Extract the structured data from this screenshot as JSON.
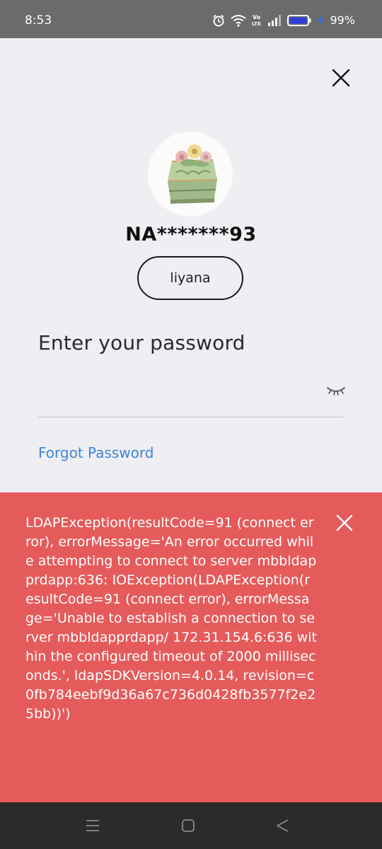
{
  "status_bar": {
    "time": "8:53",
    "battery_percent": "99%",
    "icons": [
      "alarm-icon",
      "wifi-icon",
      "volte-icon",
      "signal-icon",
      "battery-icon",
      "charging-icon"
    ]
  },
  "header": {
    "close_icon": "close-icon"
  },
  "profile": {
    "masked_id": "NA*******93",
    "username": "liyana"
  },
  "password": {
    "label": "Enter your password",
    "value": "",
    "placeholder": "",
    "toggle_icon": "eye-closed-icon"
  },
  "forgot_password": "Forgot Password",
  "error": {
    "message": "LDAPException(resultCode=91 (connect error), errorMessage='An error occurred while attempting to connect to server mbbldapprdapp:636:  IOException(LDAPException(resultCode=91 (connect error), errorMessage='Unable to establish a connection to server mbbldapprdapp/ 172.31.154.6:636 within the configured timeout of 2000 milliseconds.', ldapSDKVersion=4.0.14, revision=c0fb784eebf9d36a67c736d0428fb3577f2e25bb))')",
    "background_color": "#e55b5b",
    "close_icon": "close-icon"
  },
  "nav_bar": {
    "buttons": [
      "menu-icon",
      "home-icon",
      "back-icon"
    ]
  },
  "colors": {
    "link": "#3d86d6",
    "page_background": "#efeef3",
    "status_bar": "#6b6b6b",
    "nav_bar": "#2b2b2b"
  }
}
